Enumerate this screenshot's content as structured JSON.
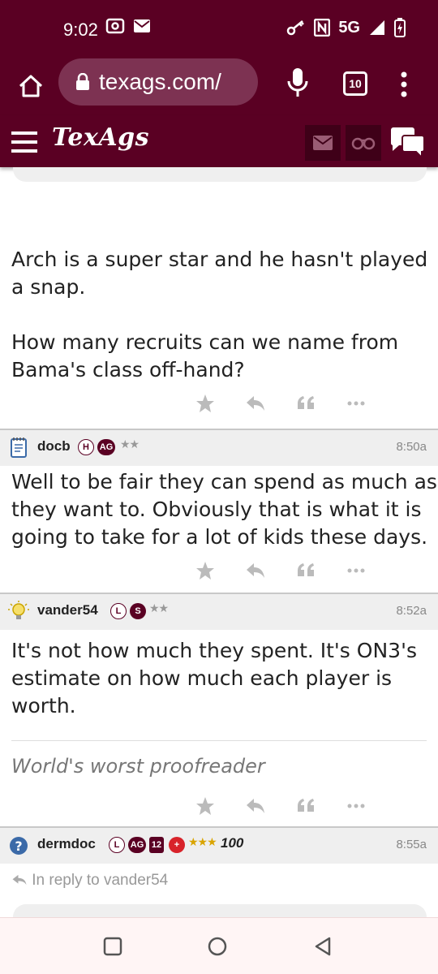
{
  "status_bar": {
    "time": "9:02",
    "network": "5G",
    "icons": [
      "screenshot-icon",
      "mail-icon",
      "key-icon",
      "nfc-icon",
      "signal-icon",
      "battery-charging-icon"
    ]
  },
  "browser": {
    "url": "texags.com/",
    "tab_count": "10"
  },
  "site_header": {
    "logo": "TexAgs"
  },
  "posts": [
    {
      "id": "post-arch",
      "text_lines": [
        "Arch is a super star and he hasn't played",
        "a snap.",
        "",
        "How many recruits can we name from",
        "Bama's class off-hand?"
      ]
    },
    {
      "id": "post-docb",
      "username": "docb",
      "badges": [
        "H",
        "AG"
      ],
      "stars": "★★",
      "time": "8:50a",
      "text_lines": [
        "Well to be fair they can spend as much as",
        "they want to. Obviously that is what it is",
        "going to take for a lot of kids these days."
      ]
    },
    {
      "id": "post-vander54",
      "username": "vander54",
      "badges": [
        "L",
        "S"
      ],
      "stars": "★★",
      "time": "8:52a",
      "text_lines": [
        "It's not how much they spent. It's ON3's",
        "estimate on how much each player is",
        "worth."
      ],
      "signature": "World's worst proofreader"
    },
    {
      "id": "post-dermdoc",
      "username": "dermdoc",
      "badges": [
        "L",
        "AG",
        "12",
        "+"
      ],
      "stars": "★★★",
      "extra_badge": "100",
      "time": "8:55a",
      "reply_to": "In reply to vander54"
    }
  ],
  "colors": {
    "brand": "#5a0023",
    "header_band": "#efefef",
    "star_gold": "#d9a400"
  }
}
